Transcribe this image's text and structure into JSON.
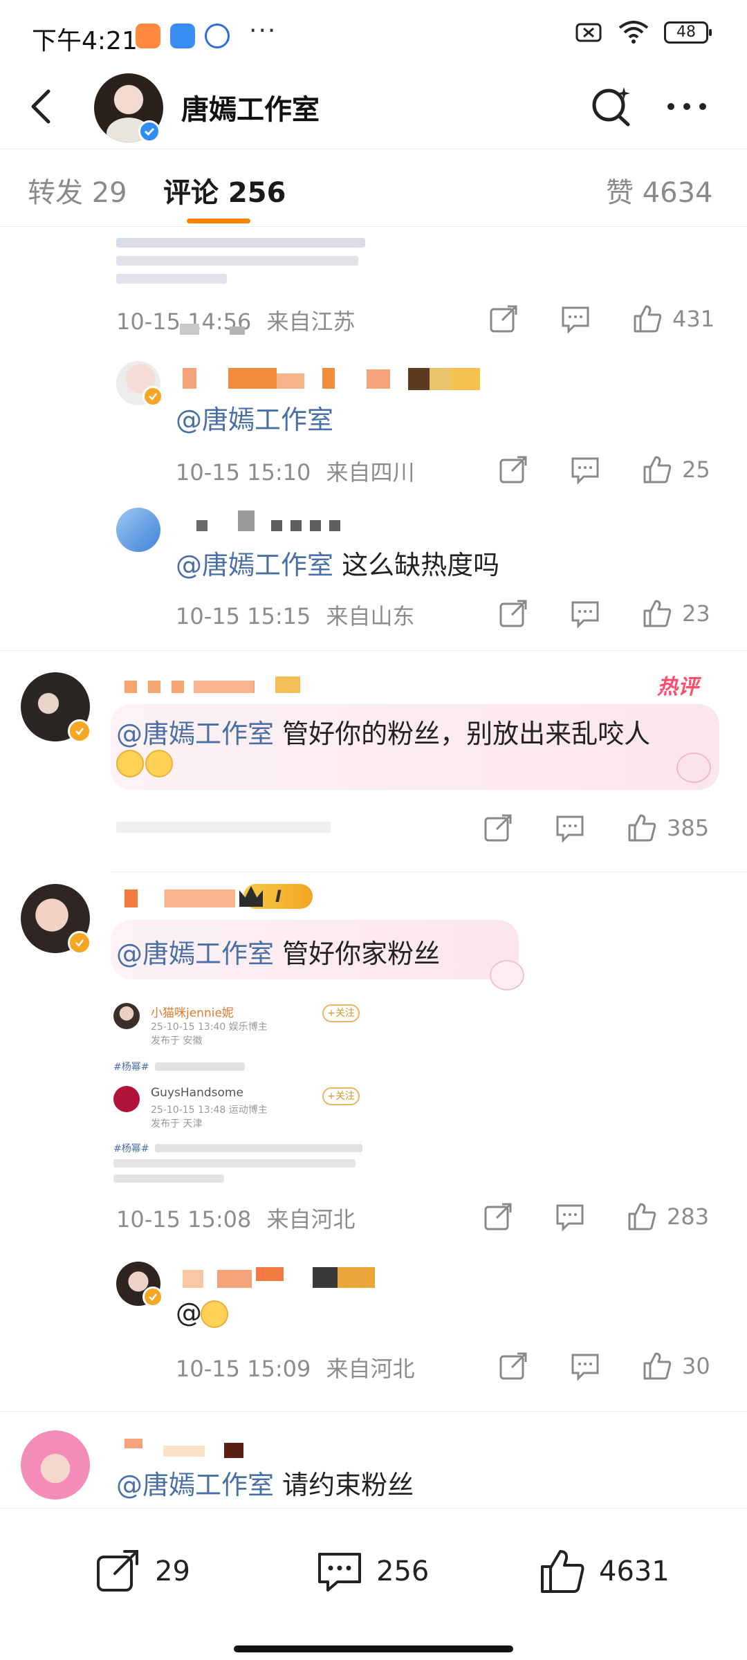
{
  "status_bar": {
    "time": "下午4:21",
    "battery": "48",
    "dots": "···"
  },
  "header": {
    "title": "唐嫣工作室"
  },
  "tabs": [
    {
      "label": "转发 29"
    },
    {
      "label": "评论 256"
    },
    {
      "label": "赞 4634"
    }
  ],
  "comments": [
    {
      "time": "10-15 14:56",
      "location": "来自江苏",
      "likes": "431"
    },
    {
      "mention": "@唐嫣工作室",
      "text": "",
      "time": "10-15 15:10",
      "location": "来自四川",
      "likes": "25"
    },
    {
      "mention": "@唐嫣工作室",
      "text": " 这么缺热度吗",
      "time": "10-15 15:15",
      "location": "来自山东",
      "likes": "23"
    },
    {
      "hot_label": "热评",
      "mention": "@唐嫣工作室",
      "text": " 管好你的粉丝，别放出来乱咬人",
      "likes": "385"
    },
    {
      "mention": "@唐嫣工作室",
      "text": " 管好你家粉丝",
      "rank_badge": "I",
      "time": "10-15 15:08",
      "location": "来自河北",
      "likes": "283",
      "embed": {
        "user1": "小猫咪jennie妮",
        "user1_meta": "25-10-15 13:40  娱乐博主",
        "user1_loc": "发布于 安徽",
        "tag": "#杨幂#",
        "user2": "GuysHandsome",
        "user2_meta": "25-10-15 13:48  运动博主",
        "user2_loc": "发布于 天津",
        "follow": "+关注"
      }
    },
    {
      "text": "@",
      "time": "10-15 15:09",
      "location": "来自河北",
      "likes": "30"
    },
    {
      "mention": "@唐嫣工作室",
      "text": " 请约束粉丝"
    }
  ],
  "bottom_bar": {
    "repost": "29",
    "comment": "256",
    "like": "4631"
  },
  "colors": {
    "accent": "#ff8200",
    "mention": "#4a6fa5",
    "verified_blue": "#2f8ef5",
    "verified_gold": "#f5a623"
  }
}
